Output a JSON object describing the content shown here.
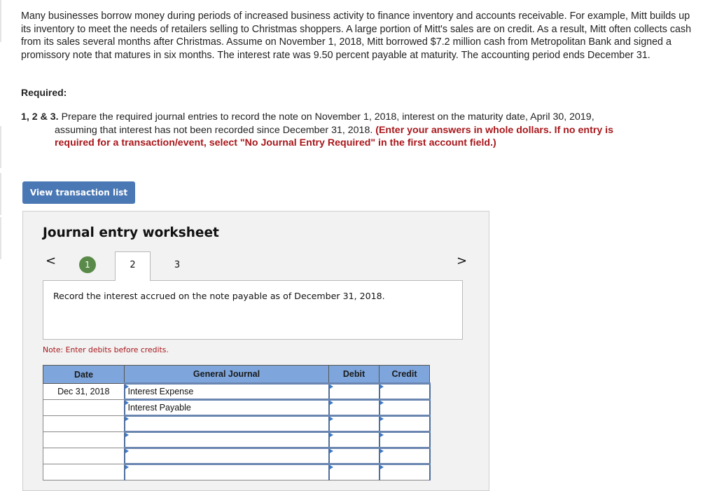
{
  "intro": "Many businesses borrow money during periods of increased business activity to finance inventory and accounts receivable. For example, Mitt builds up its inventory to meet the needs of retailers selling to Christmas shoppers. A large portion of Mitt's sales are on credit. As a result, Mitt often collects cash from its sales several months after Christmas. Assume on November 1, 2018, Mitt borrowed $7.2 million cash from Metropolitan Bank and signed a promissory note that matures in six months. The interest rate was 9.50 percent payable at maturity. The accounting period ends December 31.",
  "required": {
    "title": "Required:",
    "number": "1, 2 & 3.",
    "text_line1": " Prepare the required journal entries to record the note on November 1, 2018, interest on the maturity date, April 30, 2019,",
    "text_line2": "assuming that interest has not been recorded since December 31, 2018. ",
    "warning_a": "(Enter your answers in whole dollars. If no entry is",
    "warning_b": "required for a transaction/event, select \"No Journal Entry Required\" in the first account field.)"
  },
  "view_transaction_list_label": "View transaction list",
  "worksheet": {
    "title": "Journal entry worksheet",
    "prev_icon": "<",
    "next_icon": ">",
    "steps": [
      {
        "label": "1",
        "state": "completed"
      },
      {
        "label": "2",
        "state": "active"
      },
      {
        "label": "3",
        "state": "pending"
      }
    ],
    "prompt": "Record the interest accrued on the note payable as of December 31, 2018.",
    "note": "Note: Enter debits before credits.",
    "table": {
      "headers": [
        "Date",
        "General Journal",
        "Debit",
        "Credit"
      ],
      "rows": [
        {
          "date": "Dec 31, 2018",
          "account": "Interest Expense",
          "debit": "",
          "credit": ""
        },
        {
          "date": "",
          "account": "Interest Payable",
          "debit": "",
          "credit": ""
        },
        {
          "date": "",
          "account": "",
          "debit": "",
          "credit": ""
        },
        {
          "date": "",
          "account": "",
          "debit": "",
          "credit": ""
        },
        {
          "date": "",
          "account": "",
          "debit": "",
          "credit": ""
        },
        {
          "date": "",
          "account": "",
          "debit": "",
          "credit": ""
        }
      ]
    }
  }
}
